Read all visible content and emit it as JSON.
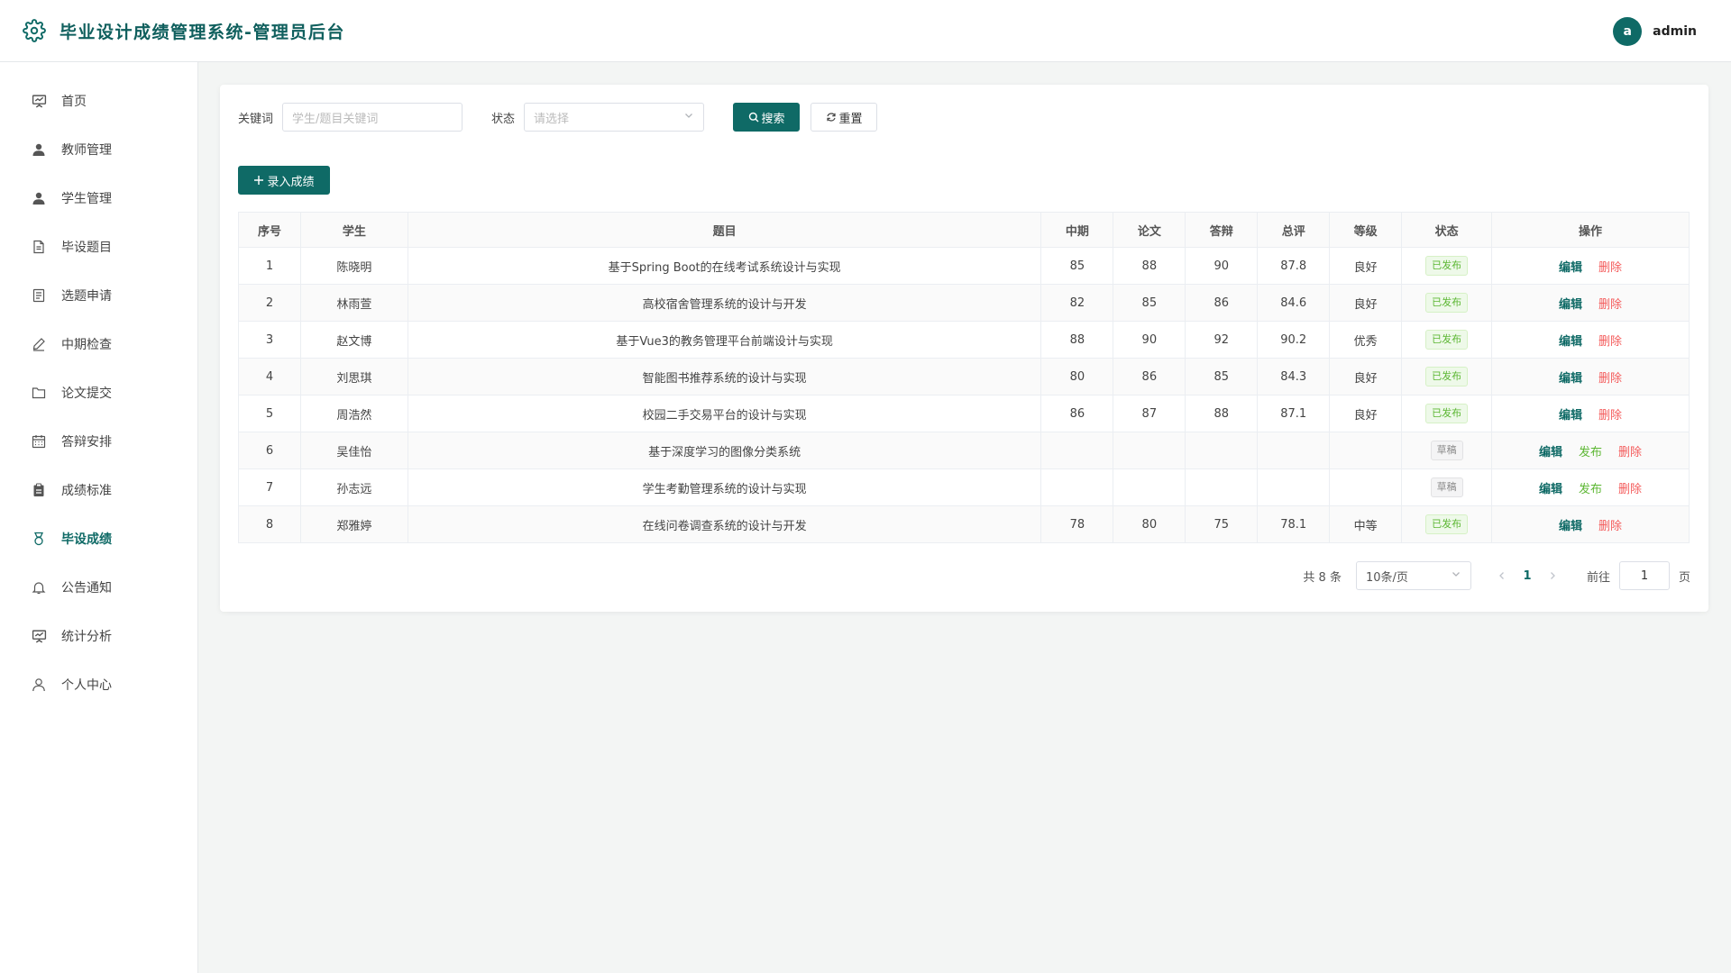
{
  "header": {
    "title": "毕业设计成绩管理系统-管理员后台",
    "user": {
      "avatar_letter": "a",
      "name": "admin"
    }
  },
  "sidebar": {
    "items": [
      {
        "label": "首页",
        "icon": "presentation-board-icon",
        "active": false
      },
      {
        "label": "教师管理",
        "icon": "user-icon",
        "active": false
      },
      {
        "label": "学生管理",
        "icon": "user-icon",
        "active": false
      },
      {
        "label": "毕设题目",
        "icon": "document-icon",
        "active": false
      },
      {
        "label": "选题申请",
        "icon": "document-list-icon",
        "active": false
      },
      {
        "label": "中期检查",
        "icon": "pen-icon",
        "active": false
      },
      {
        "label": "论文提交",
        "icon": "folder-icon",
        "active": false
      },
      {
        "label": "答辩安排",
        "icon": "calendar-icon",
        "active": false
      },
      {
        "label": "成绩标准",
        "icon": "clipboard-icon",
        "active": false
      },
      {
        "label": "毕设成绩",
        "icon": "medal-icon",
        "active": true
      },
      {
        "label": "公告通知",
        "icon": "bell-icon",
        "active": false
      },
      {
        "label": "统计分析",
        "icon": "chart-board-icon",
        "active": false
      },
      {
        "label": "个人中心",
        "icon": "user-outline-icon",
        "active": false
      }
    ]
  },
  "filter": {
    "keyword_label": "关键词",
    "keyword_placeholder": "学生/题目关键词",
    "status_label": "状态",
    "status_placeholder": "请选择",
    "search_label": "搜索",
    "reset_label": "重置"
  },
  "toolbar": {
    "add_label": "录入成绩"
  },
  "table": {
    "columns": [
      "序号",
      "学生",
      "题目",
      "中期",
      "论文",
      "答辩",
      "总评",
      "等级",
      "状态",
      "操作"
    ],
    "rows": [
      {
        "no": "1",
        "student": "陈晓明",
        "topic": "基于Spring Boot的在线考试系统设计与实现",
        "mid": "85",
        "paper": "88",
        "defense": "90",
        "total": "87.8",
        "grade": "良好",
        "status": "已发布",
        "published": true
      },
      {
        "no": "2",
        "student": "林雨萱",
        "topic": "高校宿舍管理系统的设计与开发",
        "mid": "82",
        "paper": "85",
        "defense": "86",
        "total": "84.6",
        "grade": "良好",
        "status": "已发布",
        "published": true
      },
      {
        "no": "3",
        "student": "赵文博",
        "topic": "基于Vue3的教务管理平台前端设计与实现",
        "mid": "88",
        "paper": "90",
        "defense": "92",
        "total": "90.2",
        "grade": "优秀",
        "status": "已发布",
        "published": true
      },
      {
        "no": "4",
        "student": "刘思琪",
        "topic": "智能图书推荐系统的设计与实现",
        "mid": "80",
        "paper": "86",
        "defense": "85",
        "total": "84.3",
        "grade": "良好",
        "status": "已发布",
        "published": true
      },
      {
        "no": "5",
        "student": "周浩然",
        "topic": "校园二手交易平台的设计与实现",
        "mid": "86",
        "paper": "87",
        "defense": "88",
        "total": "87.1",
        "grade": "良好",
        "status": "已发布",
        "published": true
      },
      {
        "no": "6",
        "student": "吴佳怡",
        "topic": "基于深度学习的图像分类系统",
        "mid": "",
        "paper": "",
        "defense": "",
        "total": "",
        "grade": "",
        "status": "草稿",
        "published": false
      },
      {
        "no": "7",
        "student": "孙志远",
        "topic": "学生考勤管理系统的设计与实现",
        "mid": "",
        "paper": "",
        "defense": "",
        "total": "",
        "grade": "",
        "status": "草稿",
        "published": false
      },
      {
        "no": "8",
        "student": "郑雅婷",
        "topic": "在线问卷调查系统的设计与开发",
        "mid": "78",
        "paper": "80",
        "defense": "75",
        "total": "78.1",
        "grade": "中等",
        "status": "已发布",
        "published": true
      }
    ],
    "actions": {
      "edit": "编辑",
      "publish": "发布",
      "delete": "删除"
    }
  },
  "pagination": {
    "total_text": "共 8 条",
    "page_size": "10条/页",
    "current_page": "1",
    "goto_label": "前往",
    "goto_value": "1",
    "page_suffix": "页"
  },
  "colors": {
    "primary": "#0f6a66",
    "success": "#5cb733",
    "danger": "#f45b5b"
  }
}
